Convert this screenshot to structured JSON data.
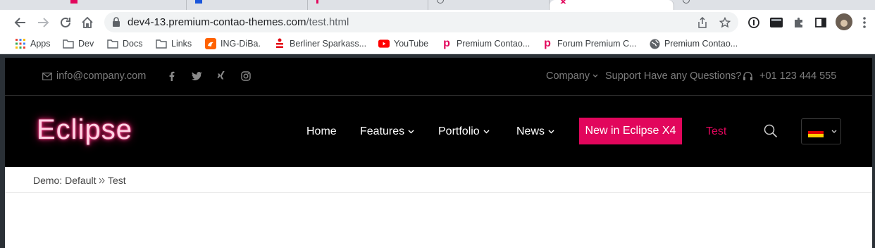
{
  "browser": {
    "url_host": "dev4-13.premium-contao-themes.com",
    "url_path": "/test.html"
  },
  "bookmarks": [
    {
      "label": "Apps",
      "icon": "apps-grid-icon"
    },
    {
      "label": "Dev",
      "icon": "folder-icon"
    },
    {
      "label": "Docs",
      "icon": "folder-icon"
    },
    {
      "label": "Links",
      "icon": "folder-icon"
    },
    {
      "label": "ING-DiBa.",
      "icon": "ing-lion-icon"
    },
    {
      "label": "Berliner Sparkass...",
      "icon": "sparkasse-icon"
    },
    {
      "label": "YouTube",
      "icon": "youtube-icon"
    },
    {
      "label": "Premium Contao...",
      "icon": "premium-p-icon"
    },
    {
      "label": "Forum Premium C...",
      "icon": "premium-p-icon"
    },
    {
      "label": "Premium Contao...",
      "icon": "globe-icon"
    }
  ],
  "topbar": {
    "email": "info@company.com",
    "company": "Company",
    "support": "Support Have any Questions?",
    "phone": "+01 123 444 555"
  },
  "header": {
    "logo": "Eclipse",
    "nav": {
      "home": "Home",
      "features": "Features",
      "portfolio": "Portfolio",
      "news": "News",
      "cta": "New in Eclipse X4",
      "test": "Test"
    }
  },
  "breadcrumb": {
    "root": "Demo: Default",
    "current": "Test"
  },
  "colors": {
    "accent": "#e2065c",
    "topbar_bg": "#000000"
  }
}
